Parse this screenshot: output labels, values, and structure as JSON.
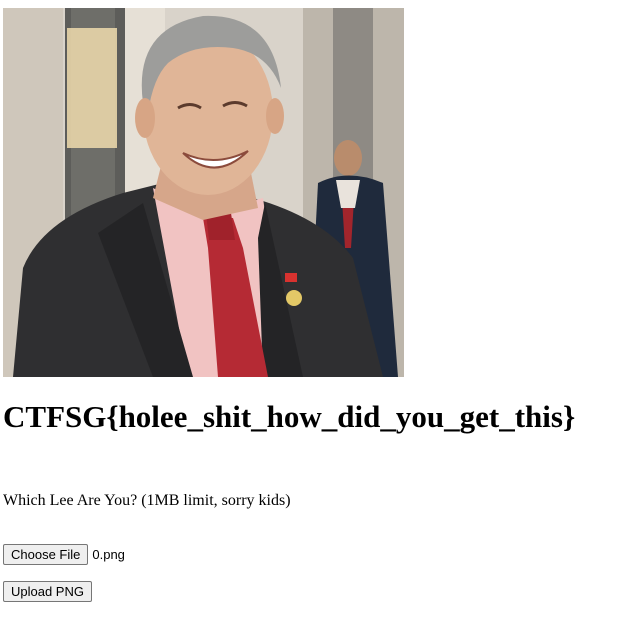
{
  "photo": {
    "alt": "Photo of a smiling man in a dark suit, pink shirt and red tie"
  },
  "heading": {
    "text": "CTFSG{holee_shit_how_did_you_get_this}"
  },
  "form": {
    "prompt": "Which Lee Are You? (1MB limit, sorry kids)",
    "choose_file_label": "Choose File",
    "selected_file": "0.png",
    "upload_label": "Upload PNG"
  }
}
